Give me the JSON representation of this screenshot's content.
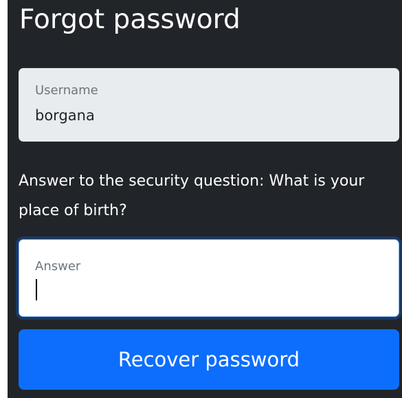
{
  "form": {
    "title": "Forgot password",
    "username": {
      "label": "Username",
      "value": "borgana"
    },
    "security_question_text": "Answer to the security question: What is your place of birth?",
    "answer": {
      "label": "Answer",
      "value": ""
    },
    "submit_label": "Recover password"
  },
  "colors": {
    "panel_background": "#212529",
    "readonly_field_background": "#e9ecef",
    "primary_button": "#0d6efd",
    "focus_ring": "#86b7fe"
  }
}
